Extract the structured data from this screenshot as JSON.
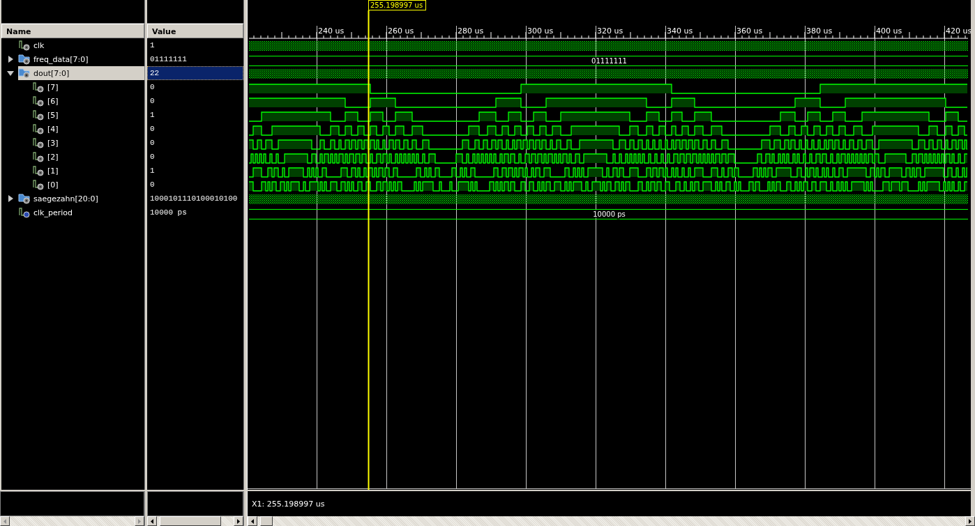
{
  "columns": {
    "name": "Name",
    "value": "Value"
  },
  "signals": [
    {
      "kind": "bit",
      "name": "clk",
      "value": "1",
      "selected": false,
      "trace": {
        "kind": "dense"
      }
    },
    {
      "kind": "bus",
      "name": "freq_data[7:0]",
      "value": "01111111",
      "selected": false,
      "expanded": false,
      "trace": {
        "kind": "label",
        "text": "01111111"
      }
    },
    {
      "kind": "bus",
      "name": "dout[7:0]",
      "value": "22",
      "selected": true,
      "expanded": true,
      "trace": {
        "kind": "dense"
      },
      "children": [
        {
          "kind": "bit",
          "name": "[7]",
          "value": "0",
          "selected": false,
          "trace": {
            "kind": "digital"
          }
        },
        {
          "kind": "bit",
          "name": "[6]",
          "value": "0",
          "selected": false,
          "trace": {
            "kind": "digital"
          }
        },
        {
          "kind": "bit",
          "name": "[5]",
          "value": "1",
          "selected": false,
          "trace": {
            "kind": "digital"
          }
        },
        {
          "kind": "bit",
          "name": "[4]",
          "value": "0",
          "selected": false,
          "trace": {
            "kind": "digital"
          }
        },
        {
          "kind": "bit",
          "name": "[3]",
          "value": "0",
          "selected": false,
          "trace": {
            "kind": "digital"
          }
        },
        {
          "kind": "bit",
          "name": "[2]",
          "value": "0",
          "selected": false,
          "trace": {
            "kind": "digital"
          }
        },
        {
          "kind": "bit",
          "name": "[1]",
          "value": "1",
          "selected": false,
          "trace": {
            "kind": "digital"
          }
        },
        {
          "kind": "bit",
          "name": "[0]",
          "value": "0",
          "selected": false,
          "trace": {
            "kind": "digital"
          }
        }
      ]
    },
    {
      "kind": "bus",
      "name": "saegezahn[20:0]",
      "value": "1000101110100010100",
      "selected": false,
      "expanded": false,
      "trace": {
        "kind": "dense"
      }
    },
    {
      "kind": "constant",
      "name": "clk_period",
      "value": "10000 ps",
      "selected": false,
      "trace": {
        "kind": "label",
        "text": "10000 ps"
      }
    }
  ],
  "ruler": {
    "labels": [
      "240 us",
      "260 us",
      "280 us",
      "300 us",
      "320 us",
      "340 us",
      "360 us",
      "380 us",
      "400 us",
      "420 us"
    ]
  },
  "cursor": {
    "label": "255.198997 us"
  },
  "status": {
    "cursor_readout": "X1: 255.198997 us"
  }
}
